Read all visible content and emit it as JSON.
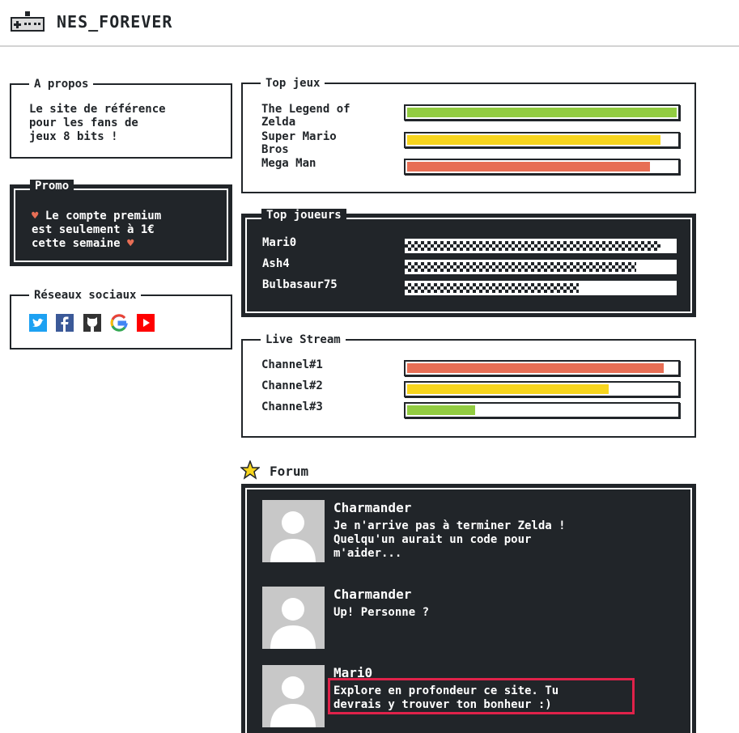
{
  "header": {
    "title": "NES_FOREVER",
    "logo_icon": "gamepad-icon"
  },
  "about": {
    "title": "A propos",
    "lines": [
      "Le site de référence",
      "pour les fans de",
      "jeux 8 bits !"
    ]
  },
  "promo": {
    "title": "Promo",
    "line1": "Le compte premium",
    "line2": "est seulement à 1€",
    "line3": "cette semaine",
    "heart": "♥"
  },
  "social": {
    "title": "Réseaux sociaux",
    "icons": [
      "twitter-icon",
      "facebook-icon",
      "github-icon",
      "google-icon",
      "youtube-icon"
    ]
  },
  "top_games": {
    "title": "Top jeux",
    "items": [
      {
        "label_line1": "The Legend of",
        "label_line2": "Zelda",
        "value": 100,
        "color": "#92cc41"
      },
      {
        "label_line1": "Super Mario",
        "label_line2": "Bros",
        "value": 95,
        "color": "#f7d51d"
      },
      {
        "label_line1": "Mega Man",
        "label_line2": "",
        "value": 90,
        "color": "#e76e55"
      }
    ]
  },
  "top_players": {
    "title": "Top joueurs",
    "items": [
      {
        "label": "Mari0",
        "value": 94
      },
      {
        "label": "Ash4",
        "value": 85
      },
      {
        "label": "Bulbasaur75",
        "value": 64
      }
    ]
  },
  "live_stream": {
    "title": "Live Stream",
    "items": [
      {
        "label": "Channel#1",
        "value": 95,
        "color": "#e76e55"
      },
      {
        "label": "Channel#2",
        "value": 75,
        "color": "#f7d51d"
      },
      {
        "label": "Channel#3",
        "value": 25,
        "color": "#92cc41"
      }
    ]
  },
  "forum": {
    "title": "Forum",
    "icon": "star-icon",
    "posts": [
      {
        "author": "Charmander",
        "message_lines": [
          "Je n'arrive pas à terminer Zelda !",
          "Quelqu'un aurait un code pour",
          "m'aider..."
        ]
      },
      {
        "author": "Charmander",
        "message_lines": [
          "Up! Personne ?"
        ]
      },
      {
        "author": "Mari0",
        "message_lines": [
          "Explore en profondeur ce site. Tu",
          "devrais y trouver ton bonheur :)"
        ]
      }
    ]
  },
  "colors": {
    "dark": "#212529",
    "green": "#92cc41",
    "yellow": "#f7d51d",
    "red": "#e76e55",
    "highlight": "#e0224a"
  }
}
